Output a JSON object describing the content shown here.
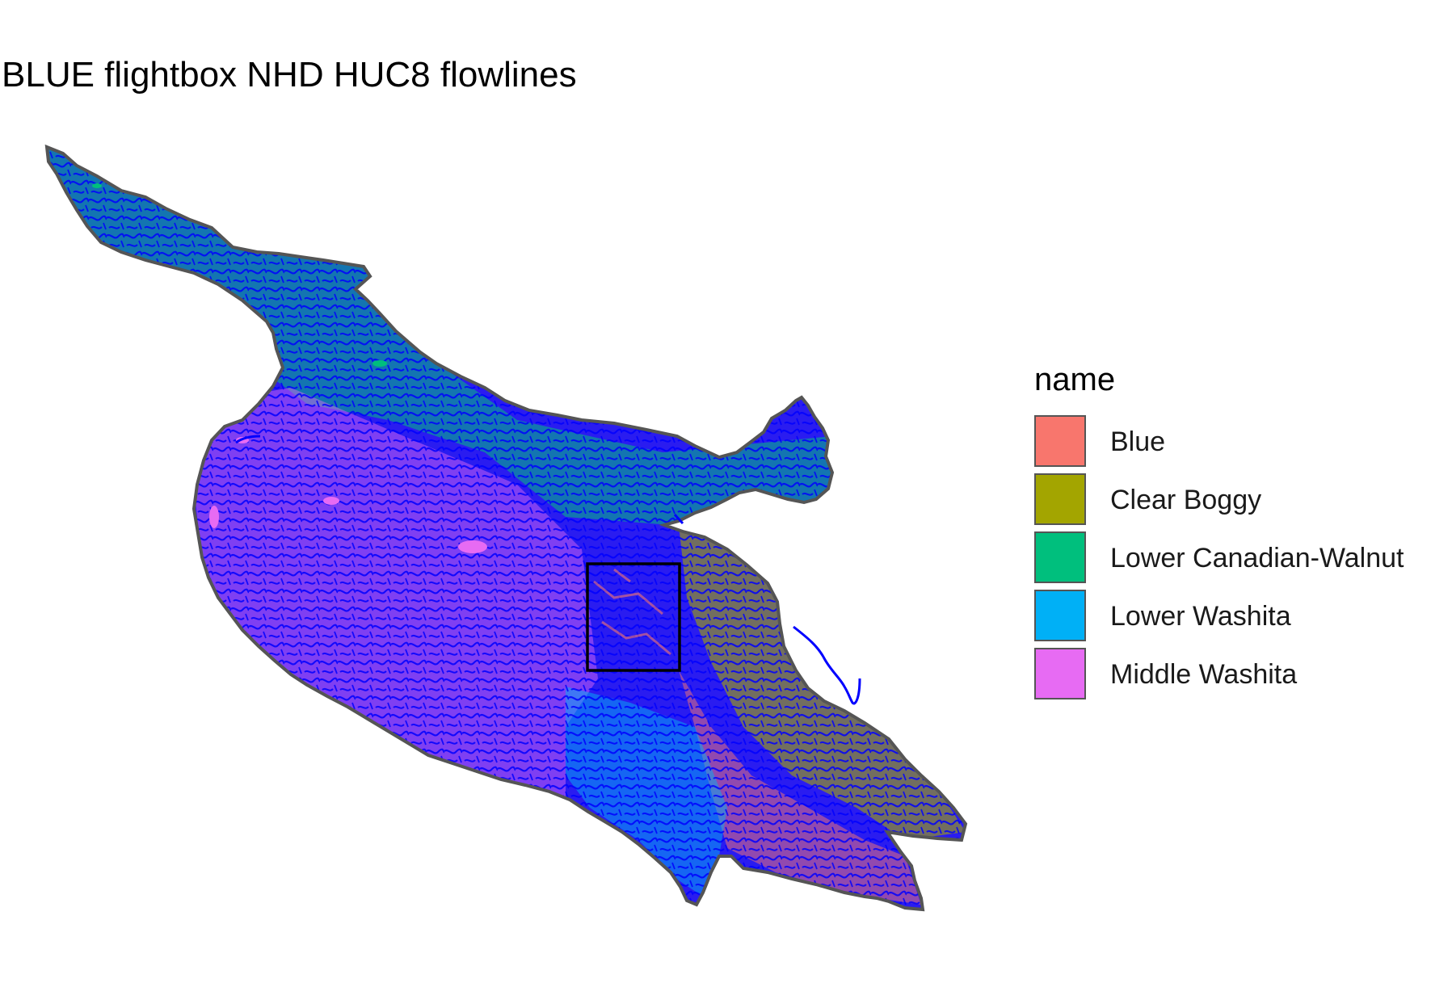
{
  "title": "BLUE flightbox NHD HUC8 flowlines",
  "legend": {
    "title": "name",
    "items": [
      {
        "label": "Blue",
        "color": "#F8766D"
      },
      {
        "label": "Clear Boggy",
        "color": "#A3A500"
      },
      {
        "label": "Lower Canadian-Walnut",
        "color": "#00BF7D"
      },
      {
        "label": "Lower Washita",
        "color": "#00B0F6"
      },
      {
        "label": "Middle Washita",
        "color": "#E76BF3"
      }
    ]
  },
  "colors": {
    "flowlines": "#0000FF",
    "boundary": "#555555",
    "flightbox": "#000000"
  }
}
